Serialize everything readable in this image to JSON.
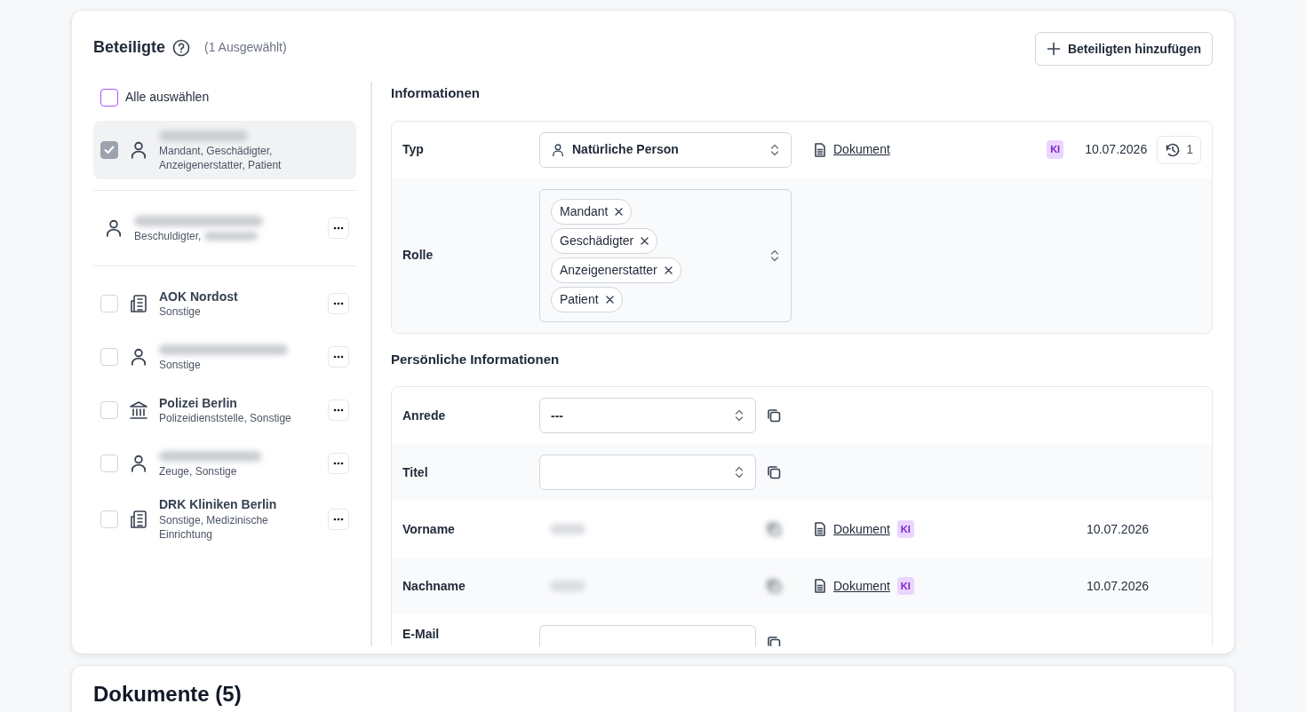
{
  "card": {
    "title": "Beteiligte",
    "selection_count": "(1 Ausgewählt)",
    "add_button": "Beteiligten hinzufügen"
  },
  "select_all": {
    "label": "Alle auswählen",
    "checked": false
  },
  "participant_groups": [
    {
      "items": [
        {
          "kind": "person",
          "roles": "Mandant, Geschädigter, Anzeigenerstatter, Patient",
          "checked": true,
          "selected": true
        }
      ]
    },
    {
      "items": [
        {
          "kind": "person",
          "roles": "Beschuldigter,",
          "roles_redacted": true,
          "selected": false
        }
      ]
    },
    {
      "items": [
        {
          "kind": "organization",
          "name": "AOK Nordost",
          "roles": "Sonstige",
          "checked": false,
          "selected": false
        },
        {
          "kind": "person",
          "roles": "Sonstige",
          "checked": false,
          "selected": false
        },
        {
          "kind": "authority",
          "name": "Polizei Berlin",
          "roles": "Polizeidienststelle, Sonstige",
          "checked": false,
          "selected": false
        },
        {
          "kind": "person",
          "roles": "Zeuge, Sonstige",
          "checked": false,
          "selected": false
        },
        {
          "kind": "organization",
          "name": "DRK Kliniken Berlin",
          "roles": "Sonstige, Medizinische Einrichtung",
          "checked": false,
          "selected": false
        }
      ]
    }
  ],
  "sections": [
    {
      "title": "Informationen",
      "rows": [
        {
          "kind": "person_select",
          "label": "Typ",
          "value": "Natürliche Person",
          "source": "Dokument",
          "ki": "KI",
          "date": "10.07.2026",
          "history": "1"
        },
        {
          "kind": "multiselect",
          "label": "Rolle",
          "chips": [
            "Mandant",
            "Geschädigter",
            "Anzeigenerstatter",
            "Patient"
          ]
        }
      ]
    },
    {
      "title": "Persönliche Informationen",
      "rows": [
        {
          "kind": "select",
          "label": "Anrede",
          "value": "---",
          "copy": true
        },
        {
          "kind": "select",
          "label": "Titel",
          "copy": true
        },
        {
          "kind": "redacted",
          "label": "Vorname",
          "copy": true,
          "source": "Dokument",
          "ki": "KI",
          "date": "10.07.2026"
        },
        {
          "kind": "redacted",
          "label": "Nachname",
          "copy": true,
          "source": "Dokument",
          "ki": "KI",
          "date": "10.07.2026"
        },
        {
          "kind": "input",
          "label": "E-Mail",
          "copy": true
        }
      ]
    }
  ],
  "next_card": {
    "title": "Dokumente (5)"
  }
}
